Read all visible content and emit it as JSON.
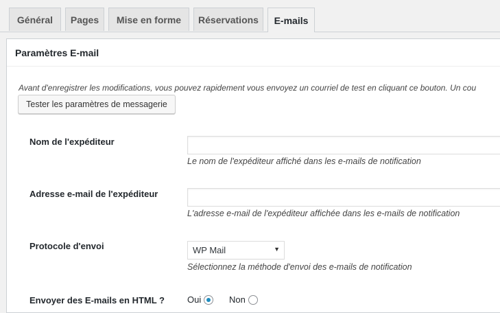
{
  "tabs": [
    {
      "label": "Général",
      "active": false
    },
    {
      "label": "Pages",
      "active": false
    },
    {
      "label": "Mise en forme",
      "active": false
    },
    {
      "label": "Réservations",
      "active": false
    },
    {
      "label": "E-mails",
      "active": true
    }
  ],
  "section": {
    "title": "Paramètres E-mail",
    "intro": "Avant d'enregistrer les modifications, vous pouvez rapidement vous envoyez un courriel de test en cliquant ce bouton. Un cou",
    "test_button": "Tester les paramètres de messagerie"
  },
  "fields": {
    "sender_name": {
      "label": "Nom de l'expéditeur",
      "value": "",
      "description": "Le nom de l'expéditeur affiché dans les e-mails de notification"
    },
    "sender_email": {
      "label": "Adresse e-mail de l'expéditeur",
      "value": "",
      "description": "L'adresse e-mail de l'expéditeur affichée dans les e-mails de notification"
    },
    "protocol": {
      "label": "Protocole d'envoi",
      "selected": "WP Mail",
      "description": "Sélectionnez la méthode d'envoi des e-mails de notification"
    },
    "html_emails": {
      "label": "Envoyer des E-mails en HTML ?",
      "option_yes": "Oui",
      "option_no": "Non",
      "selected": "Oui"
    }
  },
  "colors": {
    "accent": "#1e8cbe",
    "background": "#f1f1f1",
    "panel": "#ffffff"
  }
}
